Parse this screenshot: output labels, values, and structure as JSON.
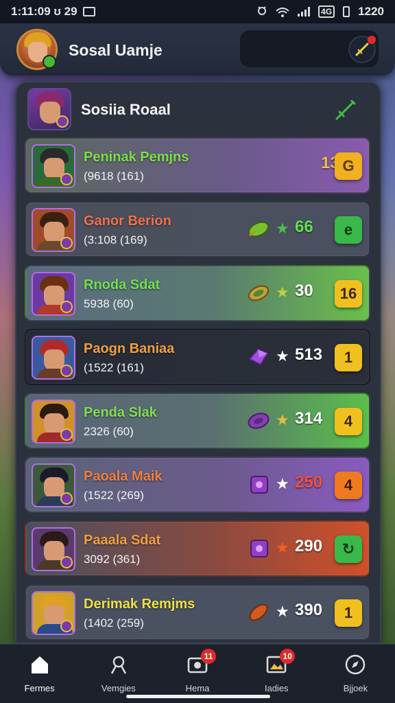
{
  "status_bar": {
    "time": "1:11:09 ʊ 29",
    "right_text": "1220",
    "icons": [
      "alarm-icon",
      "wifi-icon",
      "signal-icon",
      "data-icon",
      "battery-icon"
    ]
  },
  "header": {
    "title": "Sosal Uamje",
    "avatar_icon": "profile-avatar",
    "action_icon": "compass-icon"
  },
  "panel": {
    "title": "Sosiia Roaal",
    "action_icon": "sword-icon"
  },
  "rows": [
    {
      "name": "Peninak Pemjns",
      "sub": "(9618 (161)",
      "item_icon": "",
      "star": false,
      "score": "13",
      "badge": "G",
      "name_color": "#7be04a",
      "score_color": "#f0c040",
      "badge_color": "#f0b020",
      "badge_text_color": "#5a3a00",
      "row_bg": "linear-gradient(90deg,#5a6a5c 0%,#6a5a8a 60%,#8a5ab0 100%)",
      "avatar_bg": "#2a6a3a",
      "hair": "#2a2a2a",
      "body": "#3a6a2a"
    },
    {
      "name": "Ganor Berion",
      "sub": "(3:108 (169)",
      "item_icon": "leaf",
      "star": true,
      "star_color": "#4ac04a",
      "score": "66",
      "badge": "e",
      "name_color": "#f07050",
      "score_color": "#60e050",
      "badge_color": "#3ab84a",
      "badge_text_color": "#0a3a10",
      "row_bg": "linear-gradient(90deg,#4a4f5a 0%,#4a5060 100%)",
      "avatar_bg": "#a04a2a",
      "hair": "#3a2010",
      "body": "#6a4a2a"
    },
    {
      "name": "Rnoda Sdat",
      "sub": "5938 (60)",
      "item_icon": "leaf-gold",
      "star": true,
      "star_color": "#c0d040",
      "score": "30",
      "badge": "16",
      "name_color": "#70e050",
      "score_color": "#ffffff",
      "badge_color": "#f0c020",
      "badge_text_color": "#3a2a00",
      "row_bg": "linear-gradient(90deg,#5a6a80 0%,#5a7a70 55%,#6ac04a 100%)",
      "avatar_bg": "#6a3aa0",
      "hair": "#6a3010",
      "body": "#b03a2a"
    },
    {
      "name": "Paogn Baniaa",
      "sub": "(1522 (161)",
      "item_icon": "gem",
      "star": true,
      "star_color": "#ffffff",
      "score": "513",
      "badge": "1",
      "name_color": "#f0a040",
      "score_color": "#ffffff",
      "badge_color": "#f0c020",
      "badge_text_color": "#3a2a00",
      "row_bg": "linear-gradient(90deg,#262b36 0%,#2a2f3a 100%)",
      "avatar_bg": "#3a5aa0",
      "hair": "#b02a2a",
      "body": "#6a3a2a"
    },
    {
      "name": "Penda Slak",
      "sub": "2326 (60)",
      "item_icon": "ring",
      "star": true,
      "star_color": "#e0c040",
      "score": "314",
      "badge": "4",
      "name_color": "#80e050",
      "score_color": "#ffffff",
      "badge_color": "#f0c020",
      "badge_text_color": "#3a2a00",
      "row_bg": "linear-gradient(90deg,#5a6478 0%,#5a7070 55%,#5ac04a 100%)",
      "avatar_bg": "#d0902a",
      "hair": "#2a1a10",
      "body": "#a02a2a"
    },
    {
      "name": "Paoala Maik",
      "sub": "(1522 (269)",
      "item_icon": "square-purple",
      "star": true,
      "star_color": "#ffffff",
      "score": "250",
      "badge": "4",
      "name_color": "#f08040",
      "score_color": "#f05040",
      "badge_color": "#f07a20",
      "badge_text_color": "#3a1a00",
      "row_bg": "linear-gradient(90deg,#5a6478 0%,#6a5a8a 55%,#8a5ac0 100%)",
      "avatar_bg": "#3a5a3a",
      "hair": "#1a1a2a",
      "body": "#2a3a5a"
    },
    {
      "name": "Paaala Sdat",
      "sub": "3092 (361)",
      "item_icon": "square-purple",
      "star": true,
      "star_color": "#f06020",
      "score": "290",
      "badge": "↻",
      "name_color": "#f0a040",
      "score_color": "#ffffff",
      "badge_color": "#3ab84a",
      "badge_text_color": "#0a3a10",
      "row_bg": "linear-gradient(90deg,#4a5060 0%,#8a4a40 55%,#d0502a 100%)",
      "avatar_bg": "#5a3a6a",
      "hair": "#2a1a1a",
      "body": "#4a3a2a"
    },
    {
      "name": "Derimak Remjms",
      "sub": "(1402 (259)",
      "item_icon": "leaf-orange",
      "star": true,
      "star_color": "#ffffff",
      "score": "390",
      "badge": "1",
      "name_color": "#f0e040",
      "score_color": "#ffffff",
      "badge_color": "#f0c020",
      "badge_text_color": "#3a2a00",
      "row_bg": "linear-gradient(90deg,#4a5060 0%,#4a5262 100%)",
      "avatar_bg": "#d0a02a",
      "hair": "#e0a020",
      "body": "#2a4a8a"
    }
  ],
  "nav": [
    {
      "label": "Fermes",
      "icon": "home-icon",
      "active": true,
      "badge": ""
    },
    {
      "label": "Vemgies",
      "icon": "person-icon",
      "active": false,
      "badge": ""
    },
    {
      "label": "Hema",
      "icon": "camera-icon",
      "active": false,
      "badge": "11"
    },
    {
      "label": "Iadies",
      "icon": "photo-icon",
      "active": false,
      "badge": "10"
    },
    {
      "label": "Bjjoek",
      "icon": "compass-icon",
      "active": false,
      "badge": ""
    }
  ]
}
